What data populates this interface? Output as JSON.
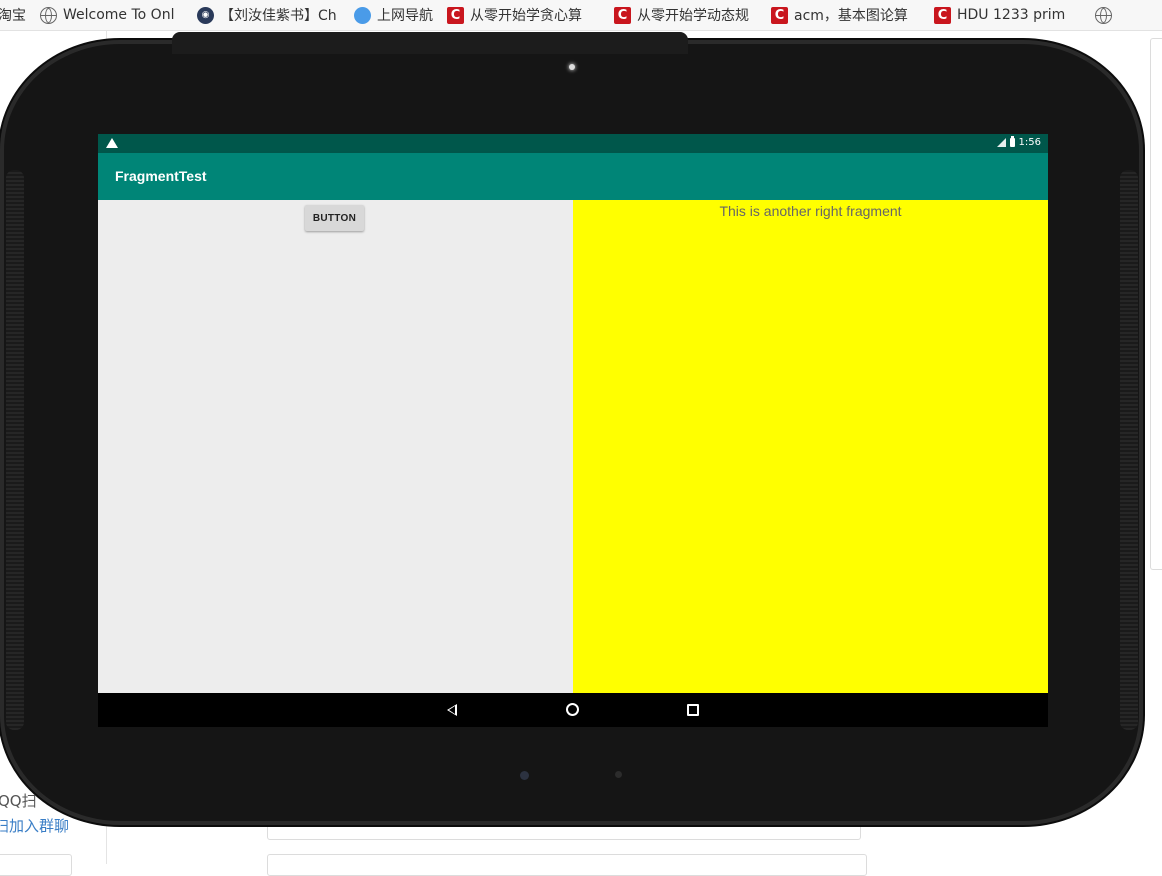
{
  "bookmarks": [
    {
      "label": "淘宝",
      "icon": "taobao-icon"
    },
    {
      "label": "Welcome To Onl",
      "icon": "globe-icon"
    },
    {
      "label": "【刘汝佳紫书】Ch",
      "icon": "cat-icon"
    },
    {
      "label": "上网导航",
      "icon": "qq-browser-icon"
    },
    {
      "label": "从零开始学贪心算",
      "icon": "csdn-icon"
    },
    {
      "label": "从零开始学动态规",
      "icon": "csdn-icon"
    },
    {
      "label": "acm，基本图论算",
      "icon": "csdn-icon"
    },
    {
      "label": "HDU 1233 prim",
      "icon": "csdn-icon"
    },
    {
      "label": "",
      "icon": "globe-icon"
    }
  ],
  "background_page": {
    "left_texts": [
      "QQ扫",
      "扫加入群聊"
    ]
  },
  "device": {
    "status_bar": {
      "time": "1:56"
    },
    "app_bar": {
      "title": "FragmentTest"
    },
    "left_fragment": {
      "button_label": "BUTTON"
    },
    "right_fragment": {
      "text": "This is another right fragment",
      "background": "#ffff00"
    },
    "colors": {
      "primary": "#008577",
      "primary_dark": "#00574b"
    }
  }
}
